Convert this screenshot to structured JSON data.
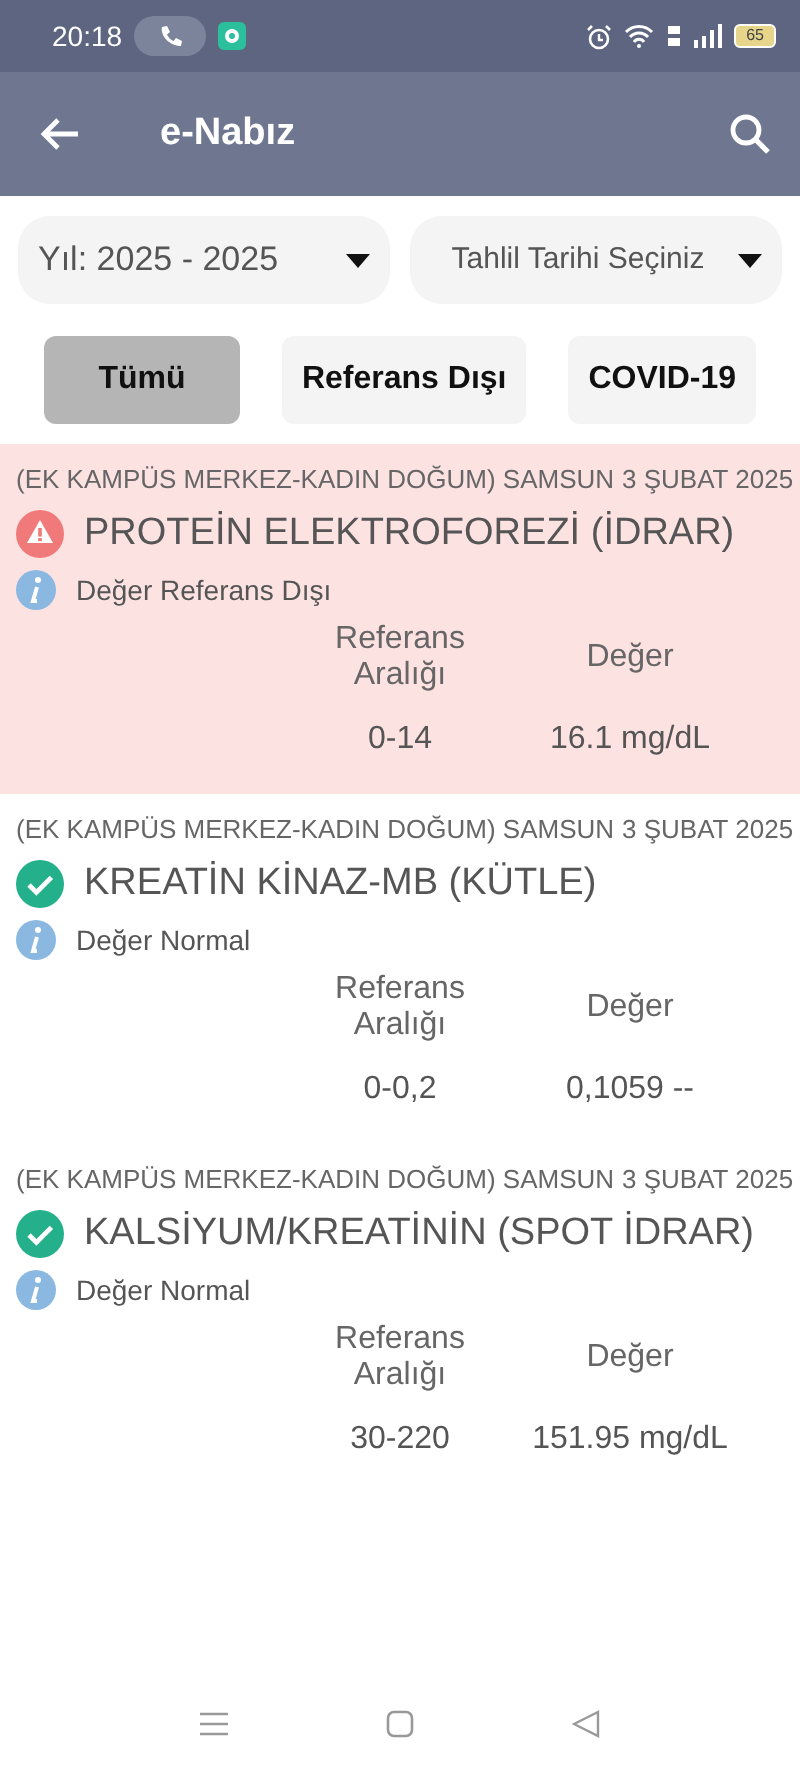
{
  "status_bar": {
    "time": "20:18",
    "battery": "65"
  },
  "app_bar": {
    "title": "e-Nabız"
  },
  "filters": {
    "year": {
      "value": "Yıl: 2025 - 2025"
    },
    "date": {
      "placeholder": "Tahlil Tarihi Seçiniz"
    }
  },
  "chips": [
    {
      "label": "Tümü",
      "selected": true
    },
    {
      "label": "Referans Dışı",
      "selected": false
    },
    {
      "label": "COVID-19",
      "selected": false
    }
  ],
  "results": [
    {
      "kind": "abnormal",
      "hospital": "(EK KAMPÜS MERKEZ-KADIN DOĞUM) SAMSUN",
      "date": "3 ŞUBAT 2025",
      "test": "PROTEİN ELEKTROFOREZİ (İDRAR)",
      "status": "Değer Referans Dışı",
      "range_header": "Referans Aralığı",
      "value_header": "Değer",
      "range": "0-14",
      "value": "16.1 mg/dL"
    },
    {
      "kind": "normal",
      "hospital": "(EK KAMPÜS MERKEZ-KADIN DOĞUM) SAMSUN",
      "date": "3 ŞUBAT 2025",
      "test": "KREATİN KİNAZ-MB (KÜTLE)",
      "status": "Değer Normal",
      "range_header": "Referans Aralığı",
      "value_header": "Değer",
      "range": "0-0,2",
      "value": "0,1059 --"
    },
    {
      "kind": "normal",
      "hospital": "(EK KAMPÜS MERKEZ-KADIN DOĞUM) SAMSUN",
      "date": "3 ŞUBAT 2025",
      "test": "KALSİYUM/KREATİNİN (SPOT İDRAR)",
      "status": "Değer Normal",
      "range_header": "Referans Aralığı",
      "value_header": "Değer",
      "range": "30-220",
      "value": "151.95 mg/dL"
    }
  ]
}
